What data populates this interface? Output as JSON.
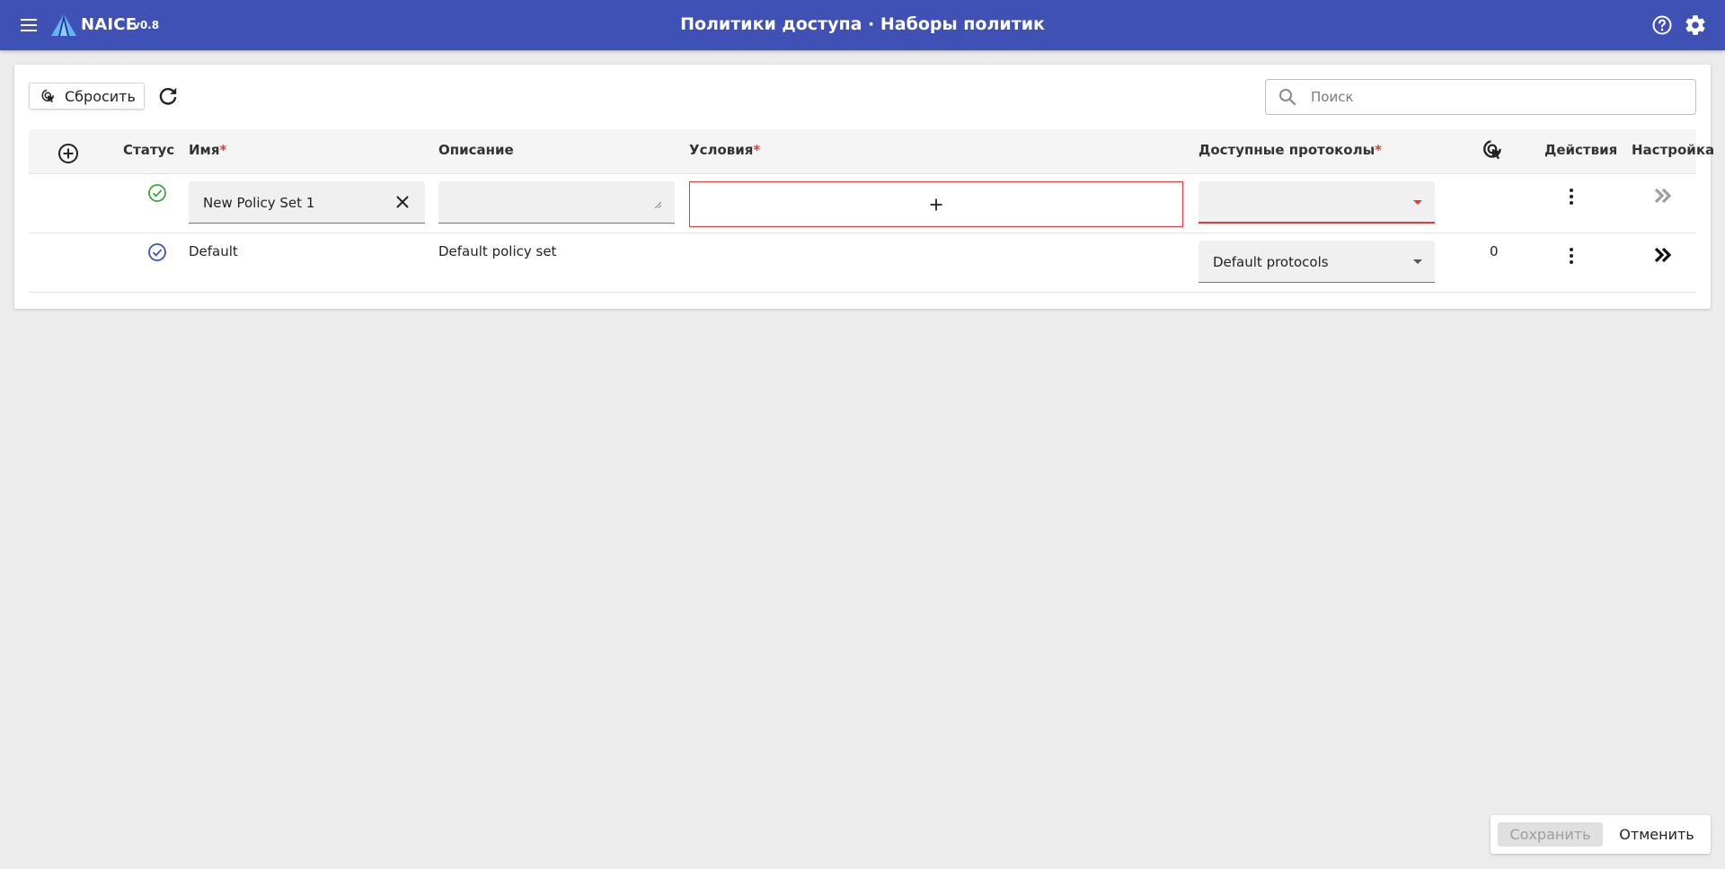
{
  "app": {
    "name": "NAICE",
    "version": "v0.8",
    "page_title": "Политики доступа · Наборы политик",
    "accent_color": "#3f51b5",
    "icons": {
      "menu": "menu-icon",
      "logo": "naice-logo",
      "help": "help-circle-icon",
      "settings": "gear-icon"
    }
  },
  "toolbar": {
    "reset_label": "Сбросить",
    "reset_icon": "reset-hits-icon",
    "refresh_icon": "refresh-icon",
    "search_placeholder": "Поиск",
    "search_value": ""
  },
  "table": {
    "columns": {
      "add_icon": "add-circle-icon",
      "status": "Статус",
      "name": "Имя",
      "description": "Описание",
      "conditions": "Условия",
      "protocols": "Доступные протоколы",
      "hits_icon": "hits-icon",
      "actions": "Действия",
      "settings": "Настройка",
      "required_mark": "*"
    },
    "rows": [
      {
        "status": "enabled",
        "status_color": "#43a047",
        "name": "New Policy Set 1",
        "description": "",
        "conditions_add": "+",
        "protocols": "",
        "hits": "",
        "editing": true
      },
      {
        "status": "enabled",
        "status_color": "#3f51b5",
        "name": "Default",
        "description": "Default policy set",
        "protocols": "Default protocols",
        "hits": "0",
        "editing": false
      }
    ]
  },
  "footer": {
    "save_label": "Сохранить",
    "cancel_label": "Отменить",
    "save_enabled": false
  }
}
